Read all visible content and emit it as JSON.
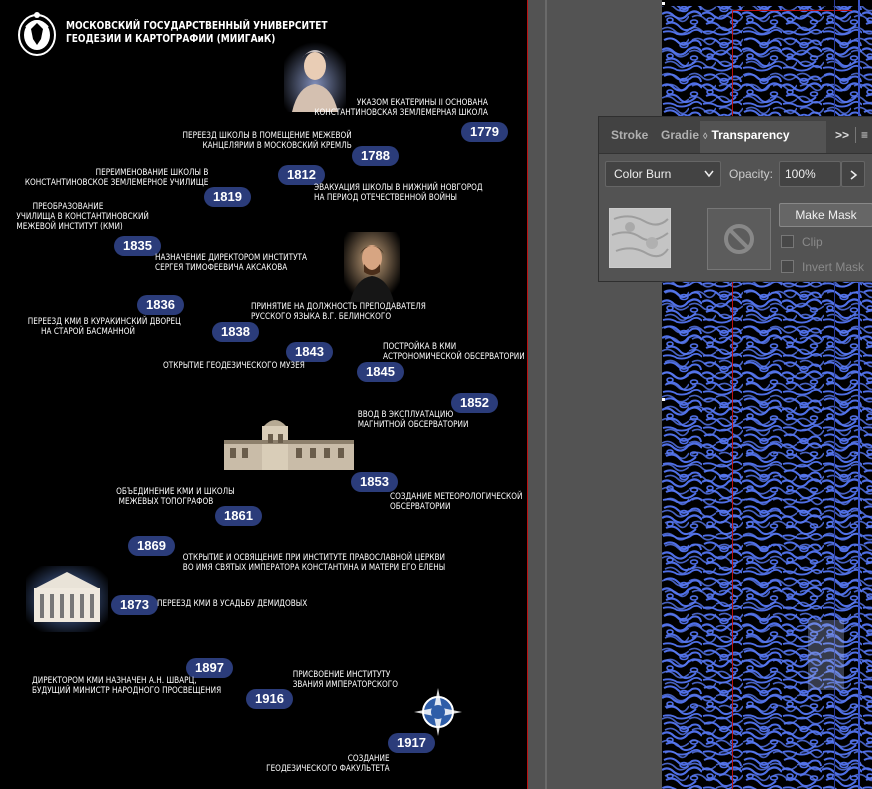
{
  "header": {
    "line1": "МОСКОВСКИЙ ГОСУДАРСТВЕННЫЙ УНИВЕРСИТЕТ",
    "line2": "ГЕОДЕЗИИ И КАРТОГРАФИИ (МИИГАиК)"
  },
  "timeline": [
    {
      "year": "1779",
      "text": [
        "УКАЗОМ ЕКАТЕРИНЫ II ОСНОВАНА",
        "КОНСТАНТИНОВСКАЯ ЗЕМЛЕМЕРНАЯ ШКОЛА"
      ]
    },
    {
      "year": "1788",
      "text": [
        "ПЕРЕЕЗД ШКОЛЫ В ПОМЕЩЕНИЕ МЕЖЕВОЙ",
        "КАНЦЕЛЯРИИ В МОСКОВСКИЙ КРЕМЛЬ"
      ]
    },
    {
      "year": "1812",
      "text": [
        "ЭВАКУАЦИЯ ШКОЛЫ В НИЖНИЙ НОВГОРОД",
        "НА ПЕРИОД ОТЕЧЕСТВЕННОЙ ВОЙНЫ"
      ]
    },
    {
      "year": "1819",
      "text": [
        "ПЕРЕИМЕНОВАНИЕ ШКОЛЫ В",
        "КОНСТАНТИНОВСКОЕ ЗЕМЛЕМЕРНОЕ УЧИЛИЩЕ"
      ]
    },
    {
      "year": "1835",
      "text": [
        "ПРЕОБРАЗОВАНИЕ",
        "УЧИЛИЩА В КОНСТАНТИНОВСКИЙ",
        "МЕЖЕВОЙ ИНСТИТУТ (КМИ)"
      ]
    },
    {
      "year": "1835b",
      "text": [
        "НАЗНАЧЕНИЕ ДИРЕКТОРОМ ИНСТИТУТА",
        "СЕРГЕЯ ТИМОФЕЕВИЧА АКСАКОВА"
      ]
    },
    {
      "year": "1836",
      "text": [
        "ПЕРЕЕЗД КМИ В КУРАКИНСКИЙ ДВОРЕЦ",
        "НА СТАРОЙ БАСМАННОЙ"
      ]
    },
    {
      "year": "1838",
      "text": [
        "ПРИНЯТИЕ НА ДОЛЖНОСТЬ ПРЕПОДАВАТЕЛЯ",
        "РУССКОГО ЯЗЫКА В.Г. БЕЛИНСКОГО"
      ]
    },
    {
      "year": "1843",
      "text": [
        "ОТКРЫТИЕ ГЕОДЕЗИЧЕСКОГО МУЗЕЯ"
      ]
    },
    {
      "year": "1845",
      "text": [
        "ПОСТРОЙКА В КМИ",
        "АСТРОНОМИЧЕСКОЙ ОБСЕРВАТОРИИ"
      ]
    },
    {
      "year": "1852",
      "text": [
        "ВВОД В ЭКСПЛУАТАЦИЮ",
        "МАГНИТНОЙ ОБСЕРВАТОРИИ"
      ]
    },
    {
      "year": "1853",
      "text": [
        "СОЗДАНИЕ МЕТЕОРОЛОГИЧЕСКОЙ",
        "ОБСЕРВАТОРИИ"
      ]
    },
    {
      "year": "1861",
      "text": [
        "ОБЪЕДИНЕНИЕ КМИ И ШКОЛЫ",
        "МЕЖЕВЫХ ТОПОГРАФОВ"
      ]
    },
    {
      "year": "1869",
      "text": [
        "ОТКРЫТИЕ И ОСВЯЩЕНИЕ ПРИ ИНСТИТУТЕ ПРАВОСЛАВНОЙ ЦЕРКВИ",
        "ВО ИМЯ СВЯТЫХ ИМПЕРАТОРА КОНСТАНТИНА И МАТЕРИ ЕГО ЕЛЕНЫ"
      ]
    },
    {
      "year": "1873",
      "text": [
        "ПЕРЕЕЗД КМИ В УСАДЬБУ ДЕМИДОВЫХ"
      ]
    },
    {
      "year": "1897",
      "text": [
        "ДИРЕКТОРОМ КМИ НАЗНАЧЕН А.Н. ШВАРЦ,",
        "БУДУЩИЙ МИНИСТР НАРОДНОГО ПРОСВЕЩЕНИЯ"
      ]
    },
    {
      "year": "1916",
      "text": [
        "ПРИСВОЕНИЕ ИНСТИТУТУ",
        "ЗВАНИЯ ИМПЕРАТОРСКОГО"
      ]
    },
    {
      "year": "1917",
      "text": [
        "СОЗДАНИЕ",
        "ГЕОДЕЗИЧЕСКОГО ФАКУЛЬТЕТА"
      ]
    }
  ],
  "labels": {
    "y1779": "1779",
    "y1788": "1788",
    "y1812": "1812",
    "y1819": "1819",
    "y1835": "1835",
    "y1836": "1836",
    "y1838": "1838",
    "y1843": "1843",
    "y1845": "1845",
    "y1852": "1852",
    "y1853": "1853",
    "y1861": "1861",
    "y1869": "1869",
    "y1873": "1873",
    "y1897": "1897",
    "y1916": "1916",
    "y1917": "1917"
  },
  "panel": {
    "tabs": [
      "Stroke",
      "Gradie",
      "Transparency"
    ],
    "overflow_glyph": ">>",
    "menu_glyph": "≡",
    "blend_mode": "Color Burn",
    "opacity_label": "Opacity:",
    "opacity_value": "100%",
    "make_mask": "Make Mask",
    "clip": "Clip",
    "invert_mask": "Invert Mask"
  },
  "colors": {
    "year_badge": "#2b3c7a",
    "artwork_outline": "#4f6fe6",
    "artboard_edge": "#b11111"
  }
}
